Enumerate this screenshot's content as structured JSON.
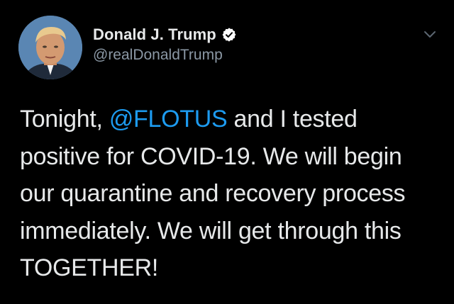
{
  "author": {
    "display_name": "Donald J. Trump",
    "handle": "@realDonaldTrump",
    "verified": true
  },
  "tweet": {
    "segments_line1": {
      "before": "Tonight, ",
      "mention": "@FLOTUS",
      "after": " and I tested"
    },
    "line2": "positive for COVID-19. We will begin",
    "line3": "our quarantine and recovery process",
    "line4": "immediately. We will get through this",
    "line5": "TOGETHER!"
  },
  "colors": {
    "background": "#000000",
    "text": "#e7e9ea",
    "secondary_text": "#8b98a5",
    "mention": "#1d9bf0"
  },
  "icons": {
    "verified": "verified-check-icon",
    "more": "chevron-down-icon"
  }
}
